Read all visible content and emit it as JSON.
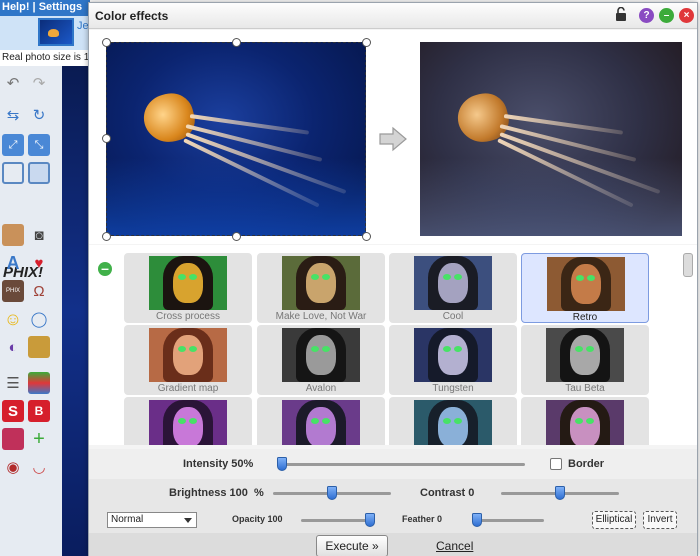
{
  "app": {
    "menu_text": "Help! | Settings",
    "thumb_text": "Je",
    "real_size_text": "Real photo size is 1",
    "logo_text": "PHIX!"
  },
  "dialog": {
    "title": "Color effects",
    "icons": [
      "lock-icon",
      "help-icon",
      "minimize-icon",
      "close-icon"
    ],
    "help_glyph": "?",
    "minimize_glyph": "–",
    "close_glyph": "×",
    "collapse_glyph": "–"
  },
  "effects": [
    {
      "label": "Cross process",
      "hair": "#1b1410",
      "face": "#d8a32e",
      "bg": "#2d8d3a",
      "selected": false
    },
    {
      "label": "Make Love, Not War",
      "hair": "#2a1c14",
      "face": "#c9a46c",
      "bg": "#5b6b3a",
      "selected": false
    },
    {
      "label": "Cool",
      "hair": "#1a1c25",
      "face": "#a4a2c0",
      "bg": "#3c4f7e",
      "selected": false
    },
    {
      "label": "Retro",
      "hair": "#3b2615",
      "face": "#c47b48",
      "bg": "#8d5a33",
      "selected": true
    },
    {
      "label": "Gradient map",
      "hair": "#6a2e1a",
      "face": "#e2a27a",
      "bg": "#b76a45",
      "selected": false
    },
    {
      "label": "Avalon",
      "hair": "#151515",
      "face": "#9a9a9a",
      "bg": "#3a3a3a",
      "selected": false
    },
    {
      "label": "Tungsten",
      "hair": "#151a2a",
      "face": "#b3b0d0",
      "bg": "#2a3565",
      "selected": false
    },
    {
      "label": "Tau Beta",
      "hair": "#141414",
      "face": "#a8a8a8",
      "bg": "#4a4a4a",
      "selected": false
    },
    {
      "label": "",
      "hair": "#2b1438",
      "face": "#c878d8",
      "bg": "#6a2e88",
      "selected": false
    },
    {
      "label": "",
      "hair": "#1c1a2a",
      "face": "#b27ad0",
      "bg": "#6a3b8a",
      "selected": false
    },
    {
      "label": "",
      "hair": "#17202b",
      "face": "#8ab0d8",
      "bg": "#2b5a6a",
      "selected": false
    },
    {
      "label": "",
      "hair": "#241a14",
      "face": "#c890c0",
      "bg": "#5a3a6a",
      "selected": false
    }
  ],
  "controls": {
    "intensity_label": "Intensity 50%",
    "intensity_value": 0.0,
    "border_label": "Border",
    "border_checked": false,
    "brightness_label": "Brightness 100",
    "brightness_unit": "%",
    "brightness_value": 0.5,
    "contrast_label": "Contrast 0",
    "contrast_value": 0.5,
    "blend_mode": "Normal",
    "opacity_label": "Opacity 100",
    "opacity_value": 1.0,
    "feather_label": "Feather 0",
    "feather_value": 0.0,
    "elliptical_label": "Elliptical",
    "invert_label": "Invert"
  },
  "footer": {
    "execute_label": "Execute »",
    "cancel_label": "Cancel"
  }
}
